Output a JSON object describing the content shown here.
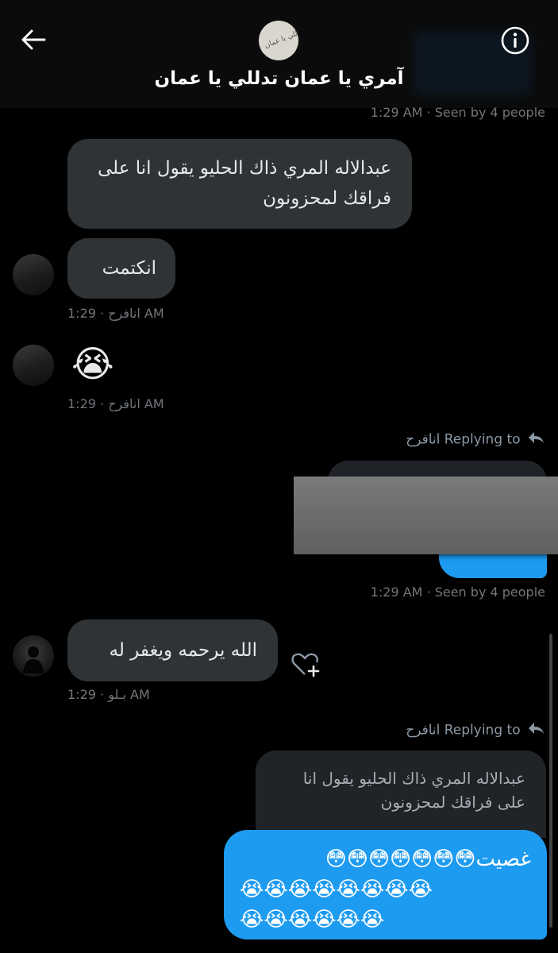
{
  "header": {
    "title": "آمري يا عمان تدللي يا عمان",
    "avatar_text": "تدللي يا عمان"
  },
  "messages": {
    "top_meta": "1:29 AM · Seen by 4 people",
    "m1_text": "عبدالاله المري ذاك الحليو يقول انا على فراقك لمحزونون",
    "m2_text": "انكتمت",
    "m2_meta": "انافرح · 1:29 AM",
    "m3_emoji": "😭",
    "m3_meta": "انافرح · 1:29 AM",
    "reply1_label": "Replying to انافرح",
    "mid_meta": "1:29 AM · Seen by 4 people",
    "m5_text": "الله يرحمه ويغفر له",
    "m5_meta": "بـلو · 1:29 AM",
    "reply2_label": "Replying to انافرح",
    "quoted_text": "عبدالاله المري ذاك الحليو يقول انا على فراقك لمحزونون",
    "final_line1": "غصيت😳😳😳😳😳😳😳",
    "final_line2": "😭😭😭😭😭😭😭😭",
    "final_line3": "😭😭😭😭😭😭"
  },
  "colors": {
    "accent": "#1d9bf0",
    "bubble_grey": "#2f3336",
    "meta_grey": "#71767b"
  },
  "icons": [
    "back-arrow-icon",
    "info-icon",
    "reply-arrow-icon",
    "add-reaction-icon"
  ]
}
